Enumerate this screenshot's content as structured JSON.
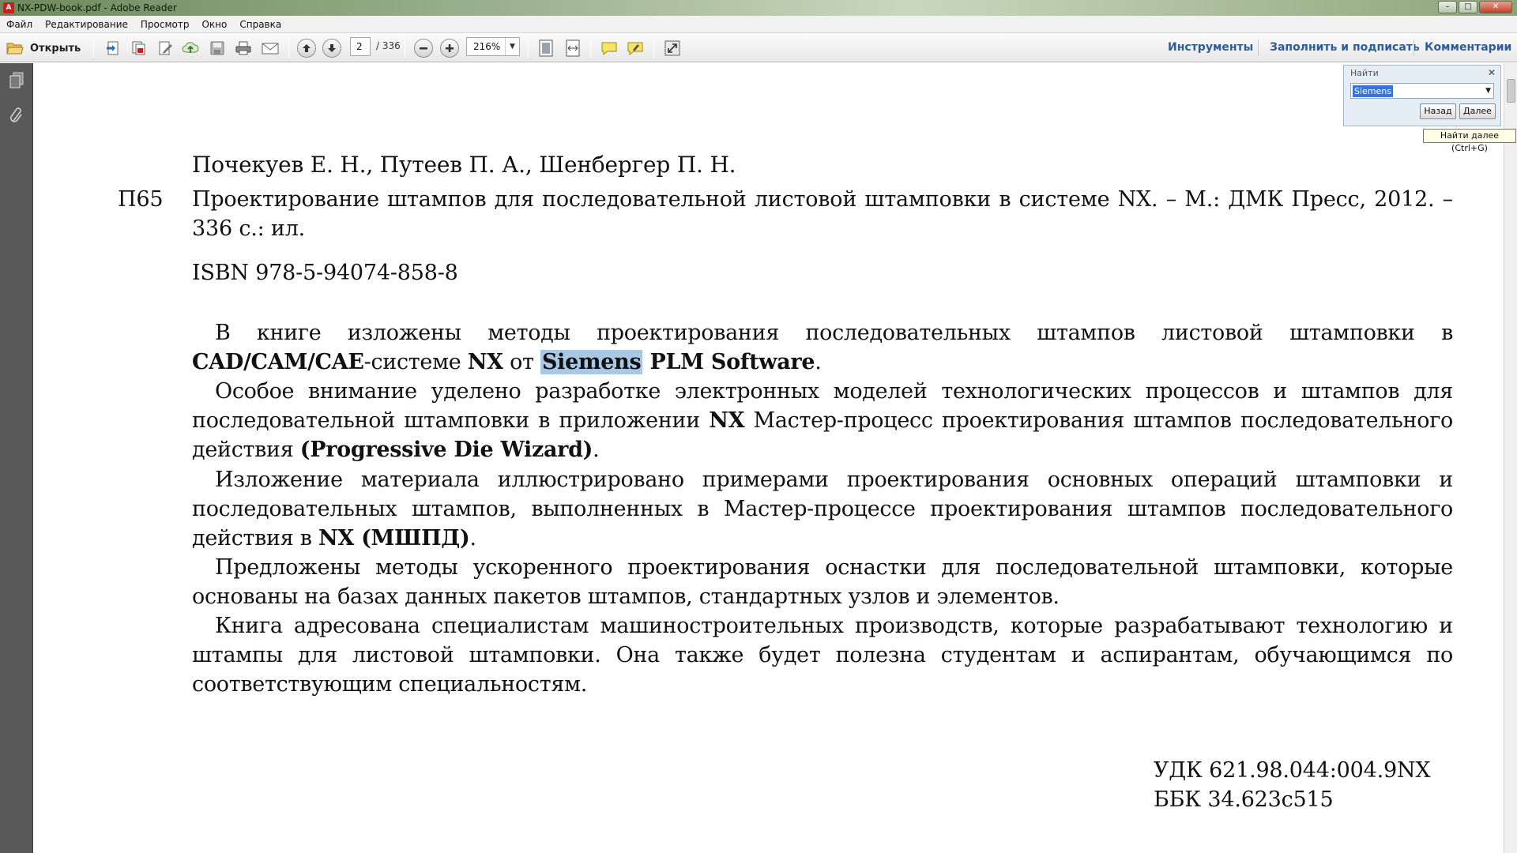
{
  "window": {
    "title": "NX-PDW-book.pdf - Adobe Reader",
    "app_icon": "adobe-reader-icon",
    "minimize": "–",
    "maximize": "□",
    "close": "✕"
  },
  "menubar": {
    "items": [
      "Файл",
      "Редактирование",
      "Просмотр",
      "Окно",
      "Справка"
    ]
  },
  "toolbar": {
    "open_label": "Открыть",
    "page_current": "2",
    "page_total": "/ 336",
    "zoom": "216%",
    "right_links": [
      "Инструменты",
      "Заполнить и подписать",
      "Комментарии"
    ]
  },
  "find": {
    "title": "Найти",
    "value": "Siemens",
    "back_label": "Назад",
    "next_label": "Далее",
    "tooltip": "Найти далее (Ctrl+G)"
  },
  "document": {
    "authors": "Почекуев Е. Н., Путеев П. А., Шенбергер П. Н.",
    "code": "П65",
    "bib_line1": "Проектирование штампов для последовательной листовой штамповки в системе NX. – М.: ДМК Пресс, 2012. –",
    "bib_line2": "336 с.: ил.",
    "isbn": "ISBN 978-5-94074-858-8",
    "p1_a": "В книге изложены  методы проектирования последовательных штампов листовой штамповки в ",
    "p1_cad": "CAD/CAM/CAE",
    "p1_b": "-системе ",
    "p1_nx": "NX",
    "p1_c": " от ",
    "p1_siemens": "Siemens",
    "p1_plm": " PLM Software",
    "p1_end": ".",
    "p2_a": "Особое внимание уделено разработке электронных моделей технологических процессов и штампов для последовательной штамповки в приложении ",
    "p2_nx": "NX",
    "p2_b": " Мастер-процесс проектирования штампов последовательного действия ",
    "p2_pdw": "(Progressive Die Wizard)",
    "p2_end": ".",
    "p3_a": "Изложение материала иллюстрировано примерами проектирования основных операций  штамповки и последовательных штампов, выполненных в Мастер-процессе проектирования штампов последовательного действия в ",
    "p3_nx": "NX (МШПД)",
    "p3_end": ".",
    "p4": "Предложены методы ускоренного проектирования оснастки для последовательной штамповки, которые основаны на базах данных пакетов штампов, стандартных узлов и элементов.",
    "p5": "Книга адресована специалистам машиностроительных производств, которые разрабатывают технологию и штампы  для листовой штамповки. Она также будет полезна студентам и аспирантам, обучающимся по соответствующим специальностям.",
    "udk": "УДК 621.98.044:004.9NX",
    "bbk": "ББК 34.623с515"
  },
  "colors": {
    "link_blue": "#2e5c9a",
    "highlight": "#a8c8e6",
    "nav_panel": "#595959"
  }
}
